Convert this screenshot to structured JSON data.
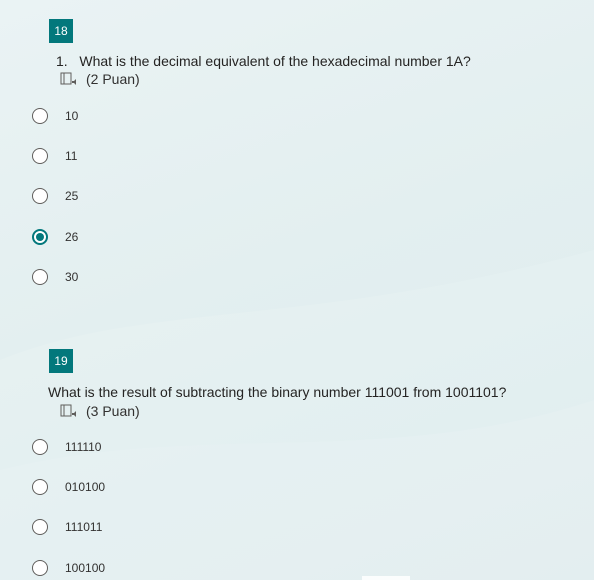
{
  "questions": [
    {
      "badge": "18",
      "number": "1.",
      "title": "What is the decimal equivalent of the hexadecimal number 1A?",
      "points": "(2 Puan)",
      "options": [
        {
          "label": "10",
          "checked": false
        },
        {
          "label": "11",
          "checked": false
        },
        {
          "label": "25",
          "checked": false
        },
        {
          "label": "26",
          "checked": true
        },
        {
          "label": "30",
          "checked": false
        }
      ]
    },
    {
      "badge": "19",
      "number": "",
      "title": "What is the result of subtracting the binary number 111001 from 1001101?",
      "points": "(3 Puan)",
      "options": [
        {
          "label": "111110",
          "checked": false
        },
        {
          "label": "010100",
          "checked": false
        },
        {
          "label": "111011",
          "checked": false
        },
        {
          "label": "100100",
          "checked": false
        }
      ]
    }
  ],
  "colors": {
    "accent": "#03787c",
    "background": "#e3eff0"
  },
  "icons": {
    "immersive_reader": "immersive-reader-icon"
  }
}
